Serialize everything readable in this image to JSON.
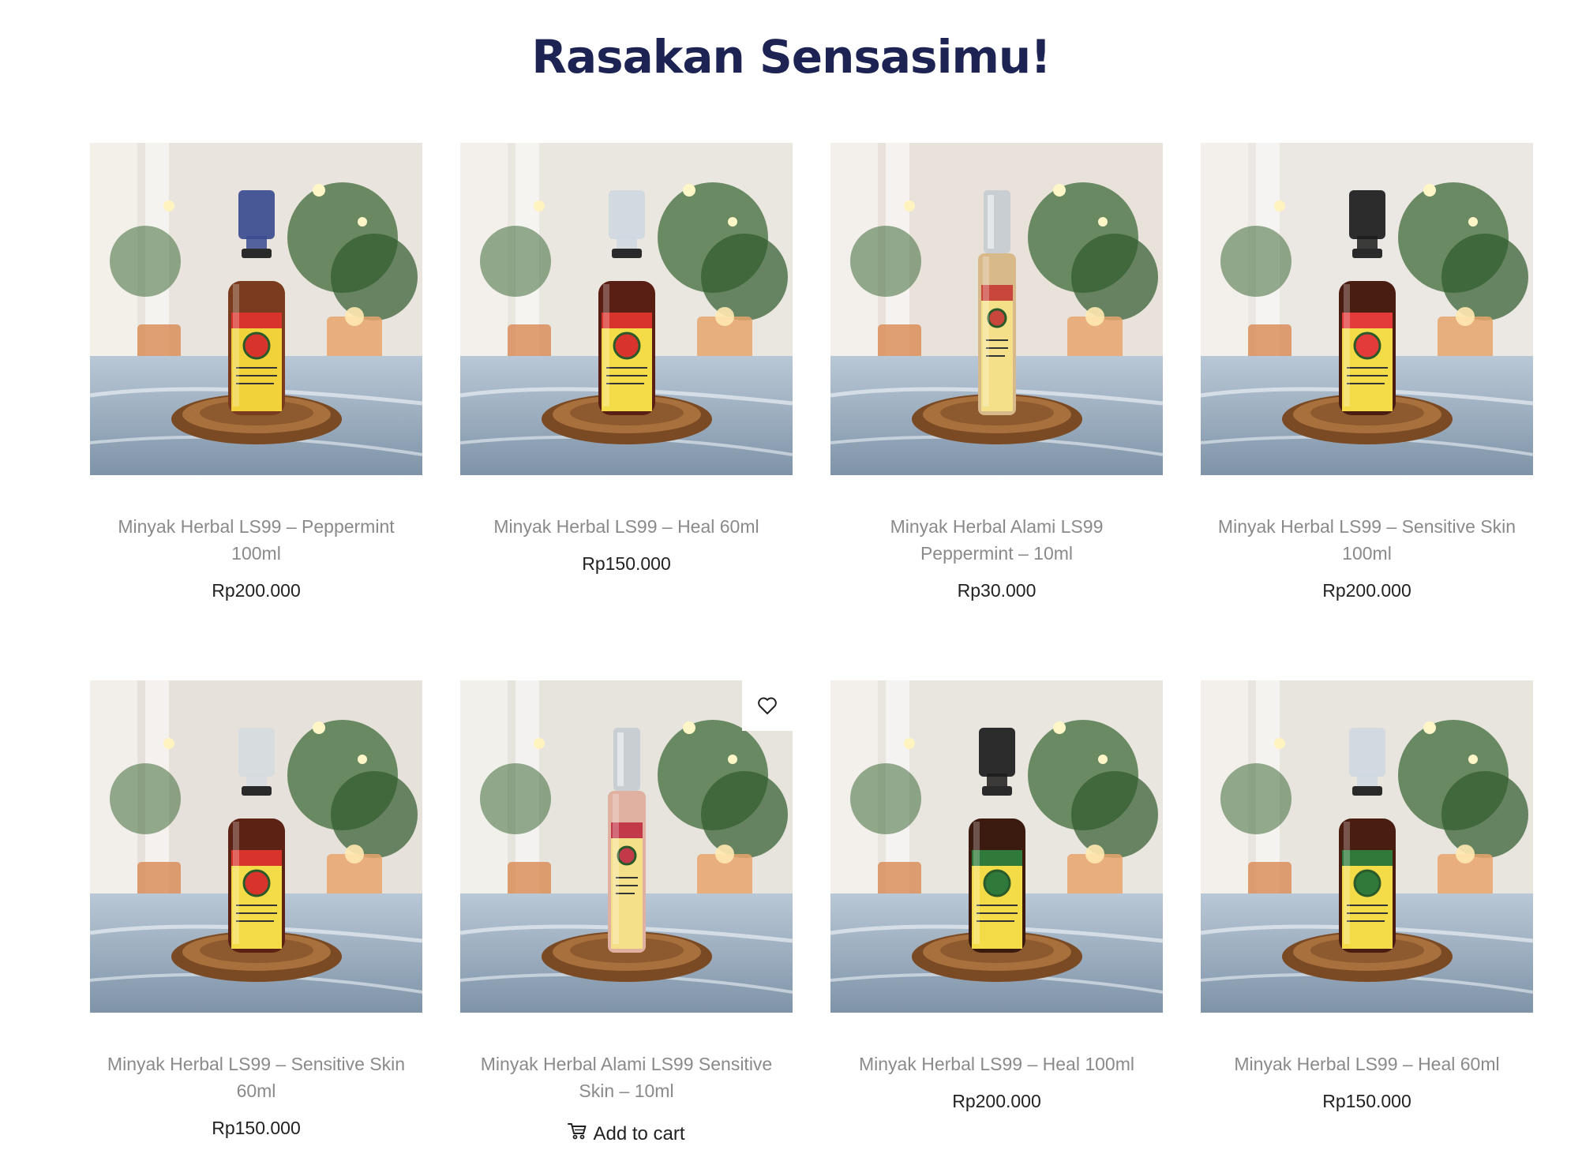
{
  "page": {
    "title": "Rasakan Sensasimu!"
  },
  "products": [
    {
      "name": "Minyak Herbal LS99 – Peppermint 100ml",
      "price": "Rp200.000",
      "bottle": "spray",
      "cap": "#3a4b8f",
      "liquid": "#7a3b1e",
      "label": "#f2d23b",
      "band": "#d9342b"
    },
    {
      "name": "Minyak Herbal LS99 – Heal 60ml",
      "price": "Rp150.000",
      "bottle": "spray",
      "cap": "#cfd8e0",
      "liquid": "#5a1f14",
      "label": "#f3dc48",
      "band": "#d9342b"
    },
    {
      "name": "Minyak Herbal Alami LS99 Peppermint – 10ml",
      "price": "Rp30.000",
      "bottle": "roller",
      "cap": "#c9ced3",
      "liquid": "#d8b98a",
      "label": "#f5e08a",
      "band": "#c9463c"
    },
    {
      "name": "Minyak Herbal LS99 – Sensitive Skin 100ml",
      "price": "Rp200.000",
      "bottle": "spray",
      "cap": "#1c1c1c",
      "liquid": "#4a1d12",
      "label": "#f3dc48",
      "band": "#e33a3a"
    },
    {
      "name": "Minyak Herbal LS99 – Sensitive Skin 60ml",
      "price": "Rp150.000",
      "bottle": "spray",
      "cap": "#d6dbe0",
      "liquid": "#5c2213",
      "label": "#f3dc48",
      "band": "#d9342b"
    },
    {
      "name": "Minyak Herbal Alami LS99 Sensitive Skin – 10ml",
      "price": "",
      "add_to_cart": "Add to cart",
      "bottle": "roller",
      "cap": "#c9ced3",
      "liquid": "#e0b0a0",
      "label": "#f5e08a",
      "band": "#c23a4a"
    },
    {
      "name": "Minyak Herbal LS99 – Heal 100ml",
      "price": "Rp200.000",
      "bottle": "spray",
      "cap": "#1c1c1c",
      "liquid": "#3b1a10",
      "label": "#f3dc48",
      "band": "#2f7a3a"
    },
    {
      "name": "Minyak Herbal LS99 – Heal 60ml",
      "price": "Rp150.000",
      "bottle": "spray",
      "cap": "#cfd8e0",
      "liquid": "#4a1d12",
      "label": "#f3dc48",
      "band": "#2f7a3a"
    }
  ],
  "icons": {
    "wishlist": "heart-icon",
    "cart": "cart-icon"
  },
  "colors": {
    "title": "#1d2352",
    "product_name": "#8a8a8a",
    "price": "#222222"
  }
}
